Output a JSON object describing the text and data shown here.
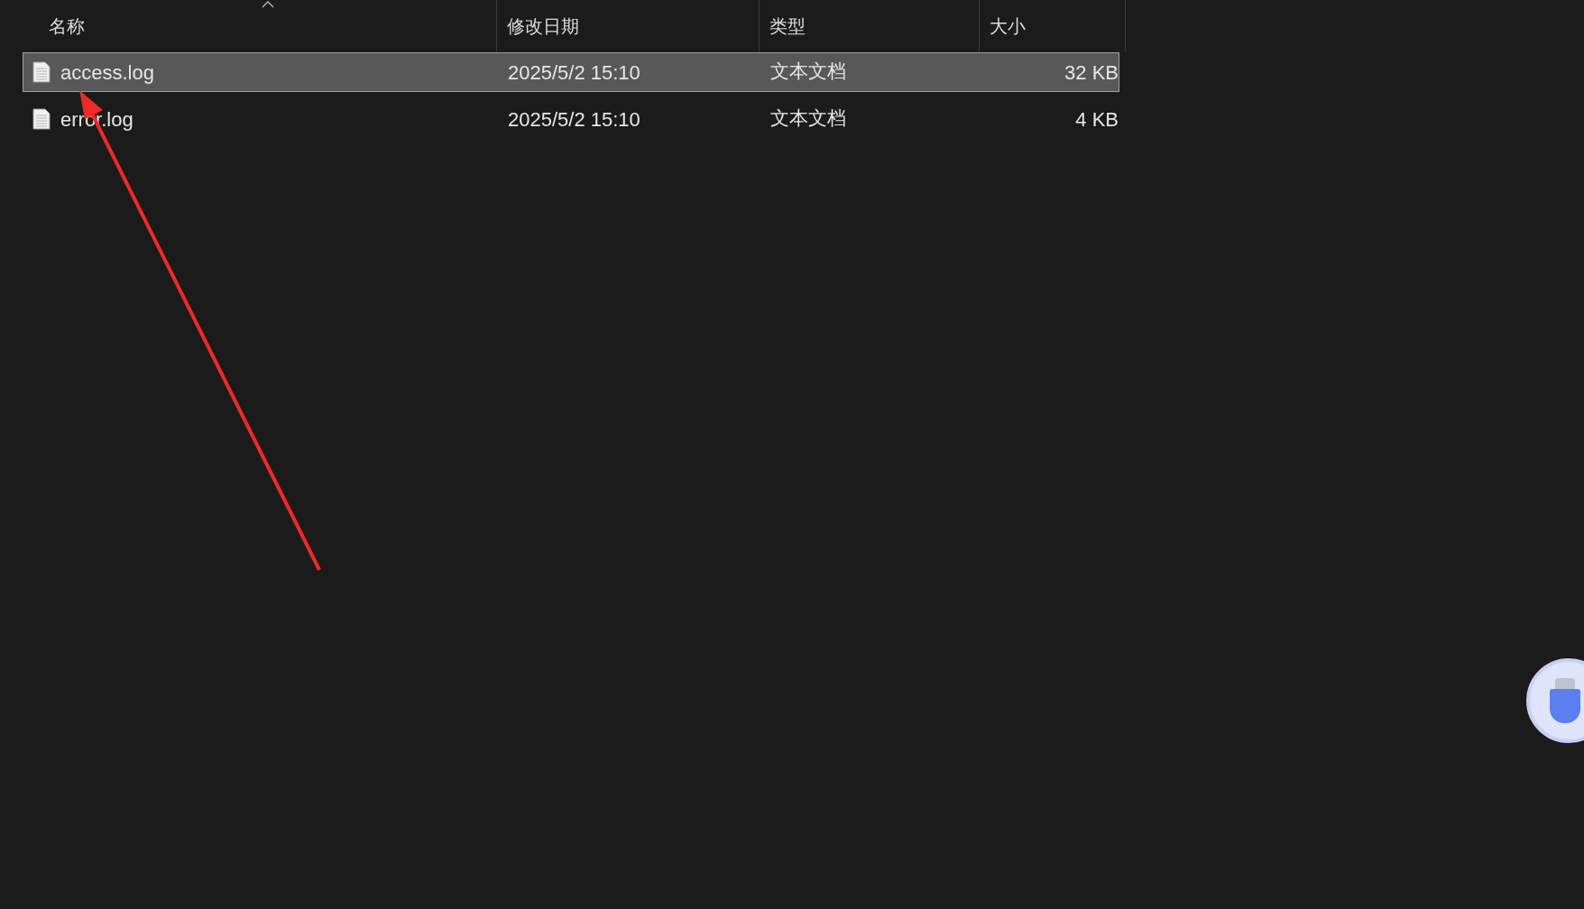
{
  "columns": [
    {
      "label": "名称"
    },
    {
      "label": "修改日期"
    },
    {
      "label": "类型"
    },
    {
      "label": "大小"
    }
  ],
  "rows": [
    {
      "name": "access.log",
      "modified": "2025/5/2 15:10",
      "type": "文本文档",
      "size": "32 KB",
      "selected": true
    },
    {
      "name": "error.log",
      "modified": "2025/5/2 15:10",
      "type": "文本文档",
      "size": "4 KB",
      "selected": false
    }
  ]
}
